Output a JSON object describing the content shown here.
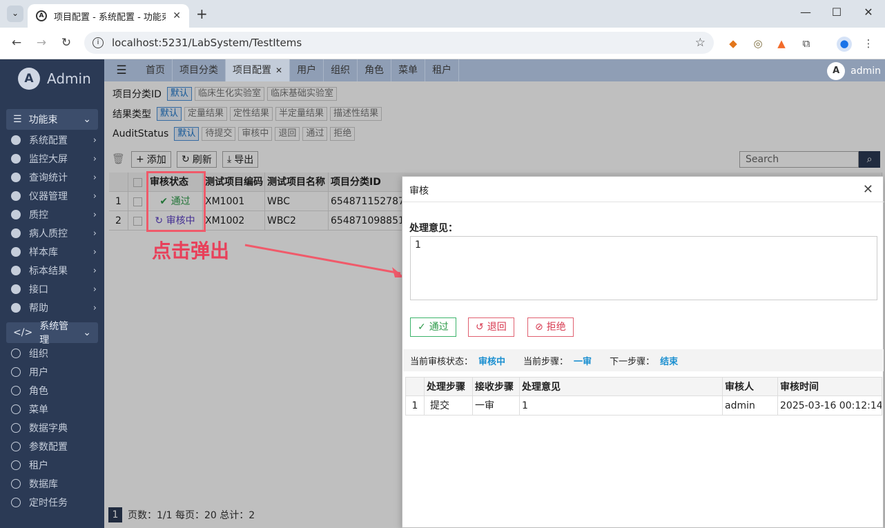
{
  "browser": {
    "tab_title": "项目配置 - 系统配置 - 功能束",
    "url": "localhost:5231/LabSystem/TestItems"
  },
  "sidebar": {
    "brand": "Admin",
    "group1": {
      "label": "功能束",
      "items": [
        "系统配置",
        "监控大屏",
        "查询统计",
        "仪器管理",
        "质控",
        "病人质控",
        "样本库",
        "标本结果",
        "接口",
        "帮助"
      ]
    },
    "group2": {
      "label": "系统管理",
      "items": [
        "组织",
        "用户",
        "角色",
        "菜单",
        "数据字典",
        "参数配置",
        "租户",
        "数据库",
        "定时任务"
      ]
    }
  },
  "topnav": {
    "tabs": [
      "首页",
      "项目分类",
      "项目配置",
      "用户",
      "组织",
      "角色",
      "菜单",
      "租户"
    ],
    "active_index": 2,
    "user": "admin"
  },
  "filters": [
    {
      "label": "项目分类ID",
      "options": [
        "默认",
        "临床生化实验室",
        "临床基础实验室"
      ]
    },
    {
      "label": "结果类型",
      "options": [
        "默认",
        "定量结果",
        "定性结果",
        "半定量结果",
        "描述性结果"
      ]
    },
    {
      "label": "AuditStatus",
      "options": [
        "默认",
        "待提交",
        "审核中",
        "退回",
        "通过",
        "拒绝"
      ]
    }
  ],
  "toolbar": {
    "add": "添加",
    "refresh": "刷新",
    "export": "导出",
    "search_placeholder": "Search"
  },
  "table": {
    "headers": [
      "审核状态",
      "测试项目编码",
      "测试项目名称",
      "项目分类ID"
    ],
    "rows": [
      {
        "no": "1",
        "status": "通过",
        "code": "XM1001",
        "name": "WBC",
        "cat": "654871152787"
      },
      {
        "no": "2",
        "status": "审核中",
        "code": "XM1002",
        "name": "WBC2",
        "cat": "654871098851"
      }
    ]
  },
  "pager": {
    "page": "1",
    "text": "页数：1/1 每页：20 总计：2"
  },
  "annotation": {
    "text": "点击弹出"
  },
  "dialog": {
    "title": "审核",
    "field_label": "处理意见：",
    "field_value": "1",
    "buttons": {
      "pass": "通过",
      "return": "退回",
      "reject": "拒绝"
    },
    "status": {
      "current_label": "当前审核状态：",
      "current_value": "审核中",
      "step_label": "当前步骤：",
      "step_value": "一审",
      "next_label": "下一步骤：",
      "next_value": "结束"
    },
    "history": {
      "headers": [
        "处理步骤",
        "接收步骤",
        "处理意见",
        "审核人",
        "审核时间"
      ],
      "rows": [
        {
          "no": "1",
          "step": "提交",
          "recv": "一审",
          "opinion": "1",
          "auditor": "admin",
          "time": "2025-03-16 00:12:14"
        }
      ]
    }
  }
}
